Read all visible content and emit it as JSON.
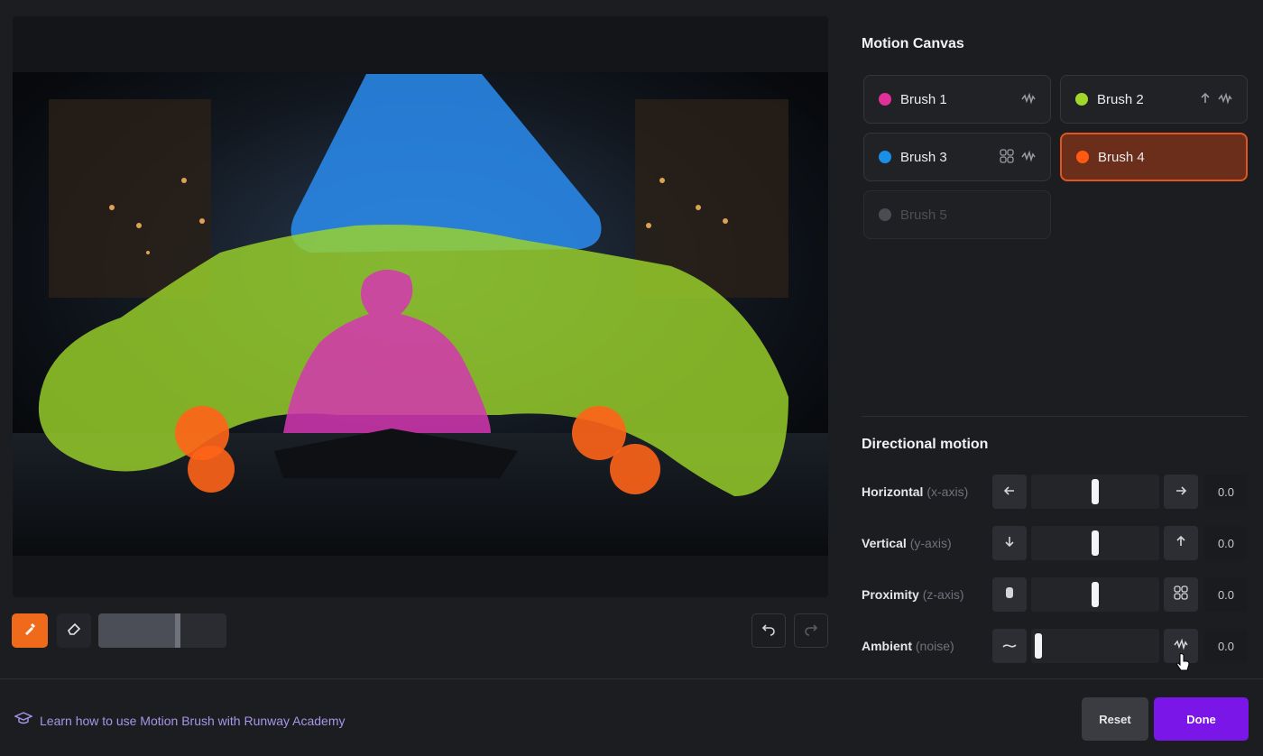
{
  "panel": {
    "title": "Motion Canvas"
  },
  "brushes": [
    {
      "name": "Brush 1",
      "color": "#e0309a",
      "icons": [
        "noise-icon"
      ],
      "state": "normal"
    },
    {
      "name": "Brush 2",
      "color": "#a3d62b",
      "icons": [
        "arrow-up-icon",
        "noise-icon"
      ],
      "state": "normal"
    },
    {
      "name": "Brush 3",
      "color": "#1a8fe8",
      "icons": [
        "proximity-icon",
        "noise-icon"
      ],
      "state": "normal"
    },
    {
      "name": "Brush 4",
      "color": "#ff5a12",
      "icons": [],
      "state": "active"
    },
    {
      "name": "Brush 5",
      "color": "#4a4c52",
      "icons": [],
      "state": "disabled"
    }
  ],
  "directional": {
    "title": "Directional motion",
    "rows": [
      {
        "label": "Horizontal",
        "sub": "(x-axis)",
        "left_icon": "arrow-left-icon",
        "right_icon": "arrow-right-icon",
        "value": "0.0",
        "level": 0.5
      },
      {
        "label": "Vertical",
        "sub": "(y-axis)",
        "left_icon": "arrow-down-icon",
        "right_icon": "arrow-up-icon",
        "value": "0.0",
        "level": 0.5
      },
      {
        "label": "Proximity",
        "sub": "(z-axis)",
        "left_icon": "recede-icon",
        "right_icon": "grid-icon",
        "value": "0.0",
        "level": 0.5
      },
      {
        "label": "Ambient",
        "sub": "(noise)",
        "left_icon": "flat-line-icon",
        "right_icon": "noise-icon",
        "value": "0.0",
        "level": 0.0
      }
    ]
  },
  "toolbar": {
    "brush_size_level": 0.62
  },
  "footer": {
    "learn_text": "Learn how to use Motion Brush with Runway Academy",
    "reset_label": "Reset",
    "done_label": "Done"
  }
}
